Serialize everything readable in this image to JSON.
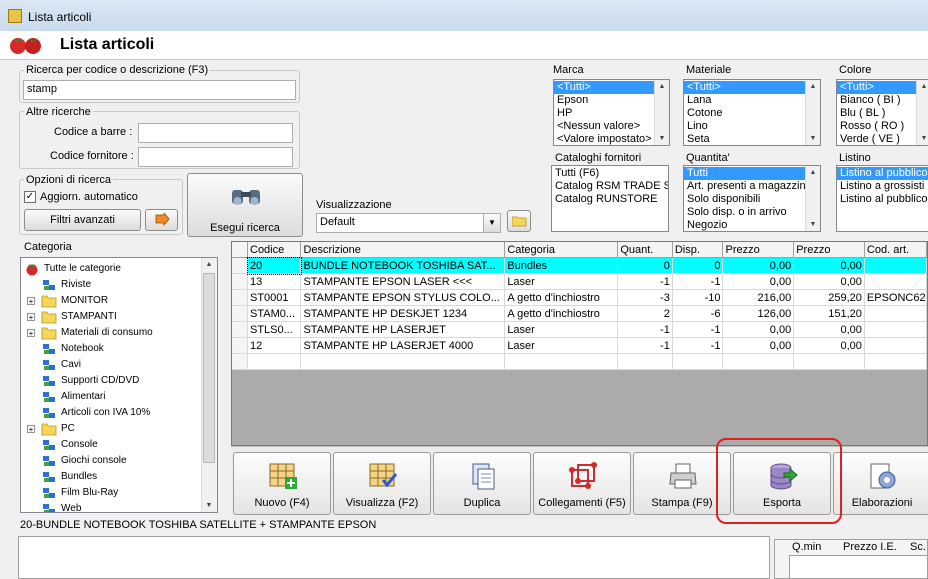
{
  "window": {
    "title": "Lista articoli"
  },
  "header": {
    "title": "Lista articoli"
  },
  "search": {
    "group_label": "Ricerca per codice o descrizione (F3)",
    "value": "stamp",
    "other_label": "Altre ricerche",
    "barcode_label": "Codice a barre :",
    "barcode_value": "",
    "supplier_code_label": "Codice fornitore :",
    "supplier_code_value": "",
    "options_label": "Opzioni di ricerca",
    "auto_update_label": "Aggiorn. automatico",
    "auto_update_checked": true,
    "advanced_filters_label": "Filtri avanzati",
    "run_search_label": "Esegui ricerca"
  },
  "view": {
    "label": "Visualizzazione",
    "selected": "Default"
  },
  "filters": {
    "marca": {
      "label": "Marca",
      "items": [
        "<Tutti>",
        "Epson",
        "HP",
        "<Nessun valore>",
        "<Valore impostato>"
      ],
      "selected": 0
    },
    "materiale": {
      "label": "Materiale",
      "items": [
        "<Tutti>",
        "Lana",
        "Cotone",
        "Lino",
        "Seta"
      ],
      "selected": 0
    },
    "colore": {
      "label": "Colore",
      "items": [
        "<Tutti>",
        "Bianco ( BI )",
        "Blu ( BL )",
        "Rosso ( RO )",
        "Verde ( VE )"
      ],
      "selected": 0
    },
    "cataloghi": {
      "label": "Cataloghi fornitori",
      "items": [
        "Tutti (F6)",
        "Catalog RSM TRADE S",
        "Catalog RUNSTORE"
      ],
      "selected": -1
    },
    "quantita": {
      "label": "Quantita'",
      "items": [
        "Tutti",
        "Art. presenti a magazzino",
        "Solo disponibili",
        "Solo disp. o in arrivo",
        "Negozio"
      ],
      "selected": 0
    },
    "listino": {
      "label": "Listino",
      "items": [
        "Listino al pubblico",
        "Listino a grossisti",
        "Listino al pubblico +"
      ],
      "selected": 0
    }
  },
  "categories": {
    "label": "Categoria",
    "items": [
      {
        "label": "Tutte le categorie",
        "icon": "strawberry-icon",
        "expander": false,
        "level": 0
      },
      {
        "label": "Riviste",
        "icon": "category-icon",
        "expander": false,
        "level": 1
      },
      {
        "label": "MONITOR",
        "icon": "folder-icon",
        "expander": true,
        "level": 1
      },
      {
        "label": "STAMPANTI",
        "icon": "folder-icon",
        "expander": true,
        "level": 1
      },
      {
        "label": "Materiali di consumo",
        "icon": "folder-icon",
        "expander": true,
        "level": 1
      },
      {
        "label": "Notebook",
        "icon": "category-icon",
        "expander": false,
        "level": 1
      },
      {
        "label": "Cavi",
        "icon": "category-icon",
        "expander": false,
        "level": 1
      },
      {
        "label": "Supporti CD/DVD",
        "icon": "category-icon",
        "expander": false,
        "level": 1
      },
      {
        "label": "Alimentari",
        "icon": "category-icon",
        "expander": false,
        "level": 1
      },
      {
        "label": "Articoli con IVA 10%",
        "icon": "category-icon",
        "expander": false,
        "level": 1
      },
      {
        "label": "PC",
        "icon": "folder-icon",
        "expander": true,
        "level": 1
      },
      {
        "label": "Console",
        "icon": "category-icon",
        "expander": false,
        "level": 1
      },
      {
        "label": "Giochi console",
        "icon": "category-icon",
        "expander": false,
        "level": 1
      },
      {
        "label": "Bundles",
        "icon": "category-icon",
        "expander": false,
        "level": 1
      },
      {
        "label": "Film Blu-Ray",
        "icon": "category-icon",
        "expander": false,
        "level": 1
      },
      {
        "label": "Web",
        "icon": "category-icon",
        "expander": false,
        "level": 1
      }
    ]
  },
  "table": {
    "columns": [
      "Codice",
      "Descrizione",
      "Categoria",
      "Quant.",
      "Disp.",
      "Prezzo",
      "Prezzo",
      "Cod. art."
    ],
    "rows": [
      [
        "20",
        "BUNDLE NOTEBOOK TOSHIBA SAT...",
        "Bundles",
        "0",
        "0",
        "0,00",
        "0,00",
        ""
      ],
      [
        "13",
        "STAMPANTE EPSON LASER <<<",
        "Laser",
        "-1",
        "-1",
        "0,00",
        "0,00",
        ""
      ],
      [
        "ST0001",
        "STAMPANTE EPSON STYLUS COLO...",
        "A getto d'inchiostro",
        "-3",
        "-10",
        "216,00",
        "259,20",
        "EPSONC62"
      ],
      [
        "STAM0...",
        "STAMPANTE HP DESKJET 1234",
        "A getto d'inchiostro",
        "2",
        "-6",
        "126,00",
        "151,20",
        ""
      ],
      [
        "STLS0...",
        "STAMPANTE HP LASERJET",
        "Laser",
        "-1",
        "-1",
        "0,00",
        "0,00",
        ""
      ],
      [
        "12",
        "STAMPANTE HP LASERJET 4000",
        "Laser",
        "-1",
        "-1",
        "0,00",
        "0,00",
        ""
      ]
    ],
    "selected_row": 0,
    "selected_color": "#00ffff"
  },
  "toolbar": [
    {
      "name": "nuovo",
      "label": "Nuovo (F4)",
      "icon": "new-grid-icon"
    },
    {
      "name": "visualizza",
      "label": "Visualizza (F2)",
      "icon": "view-grid-icon"
    },
    {
      "name": "duplica",
      "label": "Duplica",
      "icon": "duplicate-icon"
    },
    {
      "name": "collegamenti",
      "label": "Collegamenti (F5)",
      "icon": "links-icon"
    },
    {
      "name": "stampa",
      "label": "Stampa (F9)",
      "icon": "printer-icon"
    },
    {
      "name": "esporta",
      "label": "Esporta",
      "icon": "database-export-icon"
    },
    {
      "name": "elaborazioni",
      "label": "Elaborazioni",
      "icon": "gear-page-icon"
    }
  ],
  "detail": {
    "title": "20-BUNDLE NOTEBOOK TOSHIBA SATELLITE + STAMPANTE EPSON",
    "price_columns": [
      "Q.min",
      "Prezzo I.E.",
      "Sc."
    ]
  },
  "colors": {
    "highlight": "#e0201a",
    "selection": "#3399ff"
  }
}
